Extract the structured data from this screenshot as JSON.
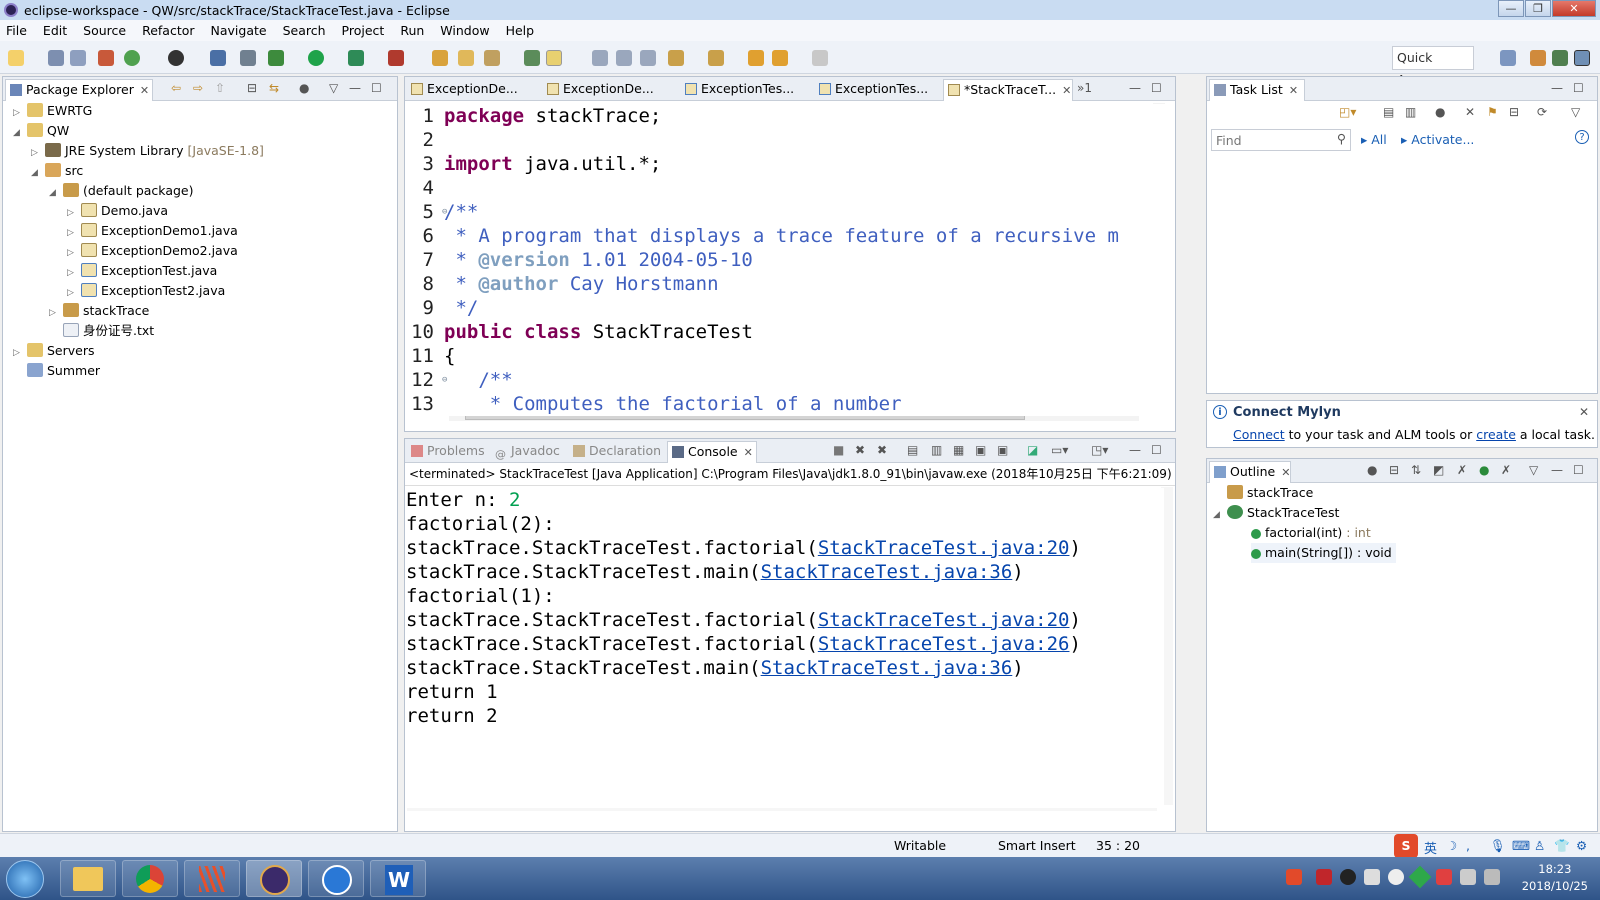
{
  "window": {
    "title": "eclipse-workspace - QW/src/stackTrace/StackTraceTest.java - Eclipse",
    "minimize": "—",
    "maximize": "❐",
    "close": "✕"
  },
  "menu": [
    "File",
    "Edit",
    "Source",
    "Refactor",
    "Navigate",
    "Search",
    "Project",
    "Run",
    "Window",
    "Help"
  ],
  "toolbar": {
    "quick_access": "Quick Access"
  },
  "package_explorer": {
    "title": "Package Explorer",
    "tree": [
      {
        "label": "EWRTG",
        "suffix": ""
      },
      {
        "label": "QW",
        "suffix": ""
      },
      {
        "label": "JRE System Library ",
        "suffix": "[JavaSE-1.8]"
      },
      {
        "label": "src",
        "suffix": ""
      },
      {
        "label": "(default package)",
        "suffix": ""
      },
      {
        "label": "Demo.java",
        "suffix": ""
      },
      {
        "label": "ExceptionDemo1.java",
        "suffix": ""
      },
      {
        "label": "ExceptionDemo2.java",
        "suffix": ""
      },
      {
        "label": "ExceptionTest.java",
        "suffix": ""
      },
      {
        "label": "ExceptionTest2.java",
        "suffix": ""
      },
      {
        "label": "stackTrace",
        "suffix": ""
      },
      {
        "label": "身份证号.txt",
        "suffix": ""
      },
      {
        "label": "Servers",
        "suffix": ""
      },
      {
        "label": "Summer",
        "suffix": ""
      }
    ]
  },
  "editor": {
    "tabs": [
      "ExceptionDe...",
      "ExceptionDe...",
      "ExceptionTes...",
      "ExceptionTes...",
      "*StackTraceT..."
    ],
    "overflow": "»1",
    "lines": [
      {
        "n": "1",
        "parts": [
          [
            "kw",
            "package"
          ],
          [
            "",
            " stackTrace;"
          ]
        ]
      },
      {
        "n": "2",
        "parts": []
      },
      {
        "n": "3",
        "parts": [
          [
            "kw",
            "import"
          ],
          [
            "",
            " java.util.*;"
          ]
        ]
      },
      {
        "n": "4",
        "parts": []
      },
      {
        "n": "5",
        "parts": [
          [
            "cm",
            "/**"
          ]
        ],
        "fold": true
      },
      {
        "n": "6",
        "parts": [
          [
            "cm",
            " * A program that displays a trace feature of a recursive m"
          ]
        ]
      },
      {
        "n": "7",
        "parts": [
          [
            "cm",
            " * "
          ],
          [
            "tag",
            "@version"
          ],
          [
            "cm",
            " 1.01 2004-05-10"
          ]
        ]
      },
      {
        "n": "8",
        "parts": [
          [
            "cm",
            " * "
          ],
          [
            "tag",
            "@author"
          ],
          [
            "cm",
            " Cay Horstmann"
          ]
        ]
      },
      {
        "n": "9",
        "parts": [
          [
            "cm",
            " */"
          ]
        ]
      },
      {
        "n": "10",
        "parts": [
          [
            "kw",
            "public"
          ],
          [
            "",
            " "
          ],
          [
            "kw",
            "class"
          ],
          [
            "",
            " StackTraceTest"
          ]
        ]
      },
      {
        "n": "11",
        "parts": [
          [
            "",
            "{"
          ]
        ]
      },
      {
        "n": "12",
        "parts": [
          [
            "cm",
            "   /**"
          ]
        ],
        "fold": true
      },
      {
        "n": "13",
        "parts": [
          [
            "cm",
            "    * Computes the factorial of a number"
          ]
        ]
      }
    ]
  },
  "console": {
    "tabs": [
      "Problems",
      "Javadoc",
      "Declaration",
      "Console"
    ],
    "header": "<terminated> StackTraceTest [Java Application] C:\\Program Files\\Java\\jdk1.8.0_91\\bin\\javaw.exe (2018年10月25日 下午6:21:09)",
    "lines": [
      {
        "pre": "Enter n: ",
        "input": "2"
      },
      {
        "pre": "factorial(2):"
      },
      {
        "pre": "stackTrace.StackTraceTest.factorial(",
        "link": "StackTraceTest.java:20",
        "post": ")"
      },
      {
        "pre": "stackTrace.StackTraceTest.main(",
        "link": "StackTraceTest.java:36",
        "post": ")"
      },
      {
        "pre": "factorial(1):"
      },
      {
        "pre": "stackTrace.StackTraceTest.factorial(",
        "link": "StackTraceTest.java:20",
        "post": ")"
      },
      {
        "pre": "stackTrace.StackTraceTest.factorial(",
        "link": "StackTraceTest.java:26",
        "post": ")"
      },
      {
        "pre": "stackTrace.StackTraceTest.main(",
        "link": "StackTraceTest.java:36",
        "post": ")"
      },
      {
        "pre": "return 1"
      },
      {
        "pre": "return 2"
      }
    ]
  },
  "task_list": {
    "title": "Task List",
    "find_placeholder": "Find",
    "all": "All",
    "activate": "Activate..."
  },
  "mylyn": {
    "title": "Connect Mylyn",
    "connect": "Connect",
    "mid": " to your task and ALM tools or ",
    "create": "create",
    "end": " a local task."
  },
  "outline": {
    "title": "Outline",
    "items": [
      "stackTrace",
      "StackTraceTest",
      "factorial(int)",
      "main(String[])"
    ],
    "types": [
      "",
      "",
      " : int",
      " : void"
    ]
  },
  "status": {
    "writable": "Writable",
    "insert_mode": "Smart Insert",
    "position": "35 : 20"
  },
  "taskbar": {
    "ime": "英",
    "time": "18:23",
    "date": "2018/10/25"
  }
}
